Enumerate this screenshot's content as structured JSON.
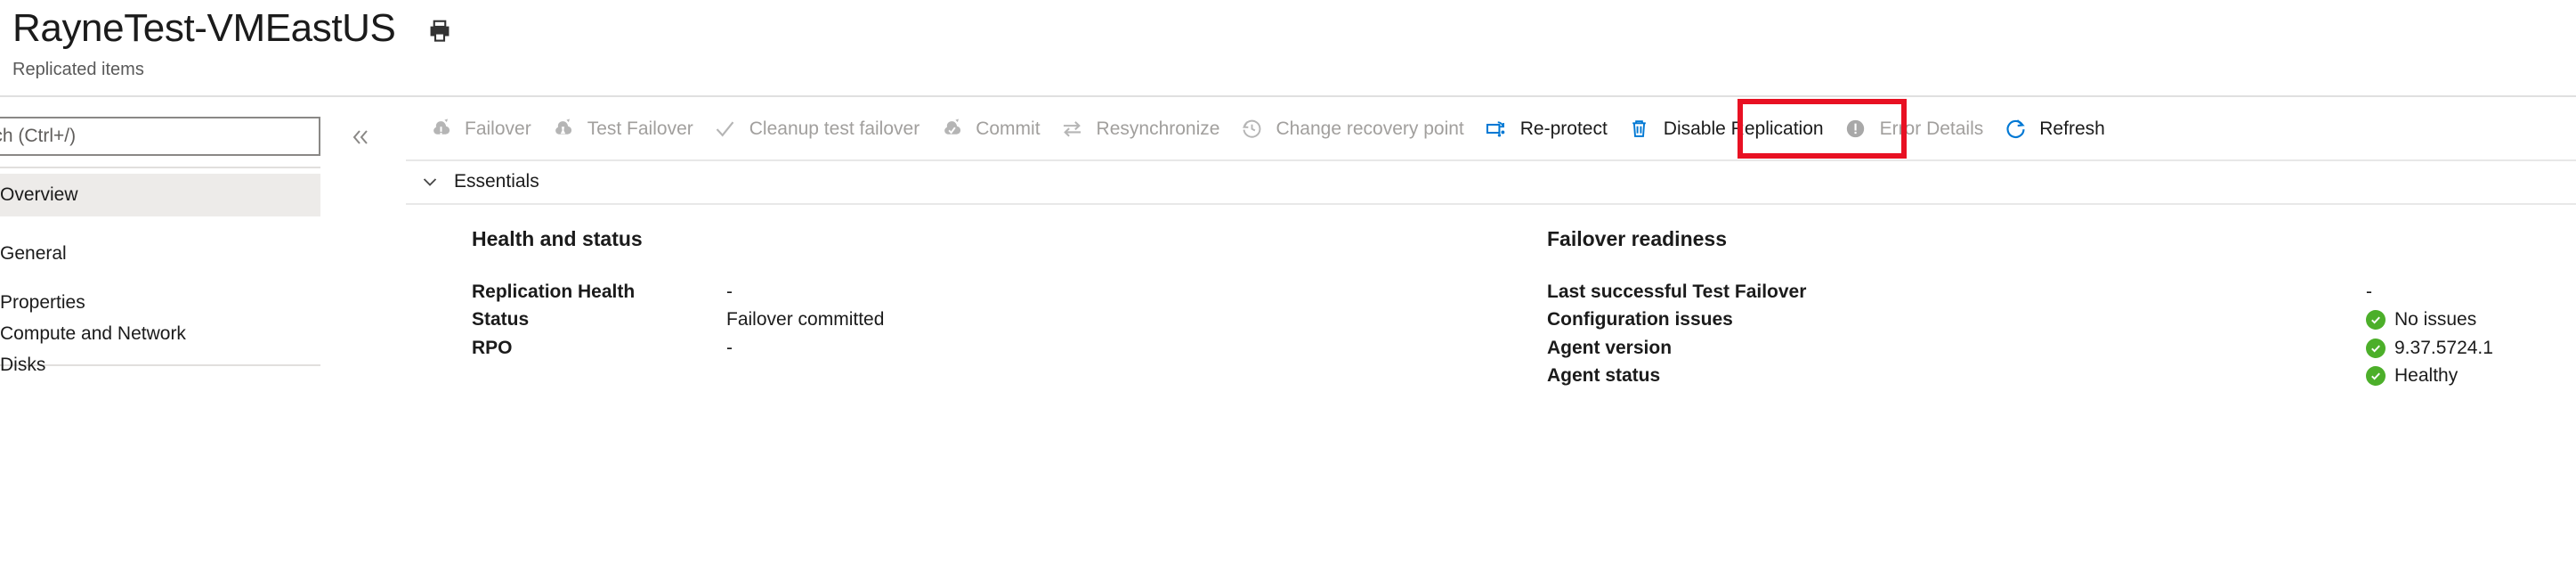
{
  "header": {
    "title": "RayneTest-VMEastUS",
    "subtitle": "Replicated items",
    "print_icon": "print-icon"
  },
  "sidebar": {
    "search": {
      "placeholder": "Search (Ctrl+/)",
      "value": ""
    },
    "collapse_icon": "chevron-double-left-icon",
    "items": [
      {
        "label": "Overview",
        "selected": true,
        "type": "item"
      },
      {
        "label": "General",
        "selected": false,
        "type": "section"
      },
      {
        "label": "Properties",
        "selected": false,
        "type": "item"
      },
      {
        "label": "Compute and Network",
        "selected": false,
        "type": "item"
      },
      {
        "label": "Disks",
        "selected": false,
        "type": "item"
      }
    ]
  },
  "toolbar": {
    "commands": [
      {
        "label": "Failover",
        "icon": "failover-icon",
        "enabled": false
      },
      {
        "label": "Test Failover",
        "icon": "test-failover-icon",
        "enabled": false
      },
      {
        "label": "Cleanup test failover",
        "icon": "checkmark-icon",
        "enabled": false
      },
      {
        "label": "Commit",
        "icon": "commit-icon",
        "enabled": false
      },
      {
        "label": "Resynchronize",
        "icon": "resynchronize-icon",
        "enabled": false
      },
      {
        "label": "Change recovery point",
        "icon": "clock-history-icon",
        "enabled": false
      },
      {
        "label": "Re-protect",
        "icon": "re-protect-icon",
        "enabled": true
      },
      {
        "label": "Disable Replication",
        "icon": "trash-icon",
        "enabled": true
      },
      {
        "label": "Error Details",
        "icon": "error-circle-icon",
        "enabled": false
      },
      {
        "label": "Refresh",
        "icon": "refresh-icon",
        "enabled": true
      }
    ],
    "highlight": {
      "target_label": "Re-protect",
      "color": "#e81123"
    }
  },
  "essentials": {
    "label": "Essentials",
    "chevron_icon": "chevron-down-icon",
    "expanded": true
  },
  "main": {
    "left_column": {
      "title": "Health and status",
      "rows": [
        {
          "key": "Replication Health",
          "value": "-",
          "status": "none"
        },
        {
          "key": "Status",
          "value": "Failover committed",
          "status": "none"
        },
        {
          "key": "RPO",
          "value": "-",
          "status": "none"
        }
      ]
    },
    "right_column": {
      "title": "Failover readiness",
      "rows": [
        {
          "key": "Last successful Test Failover",
          "value": "-",
          "status": "none"
        },
        {
          "key": "Configuration issues",
          "value": "No issues",
          "status": "ok"
        },
        {
          "key": "Agent version",
          "value": "9.37.5724.1",
          "status": "ok"
        },
        {
          "key": "Agent status",
          "value": "Healthy",
          "status": "ok"
        }
      ]
    }
  },
  "colors": {
    "accent_blue": "#0078d4",
    "status_green": "#4caf2a",
    "highlight_red": "#e81123",
    "disabled_gray": "#a19f9d",
    "text": "#1b1b1b"
  }
}
